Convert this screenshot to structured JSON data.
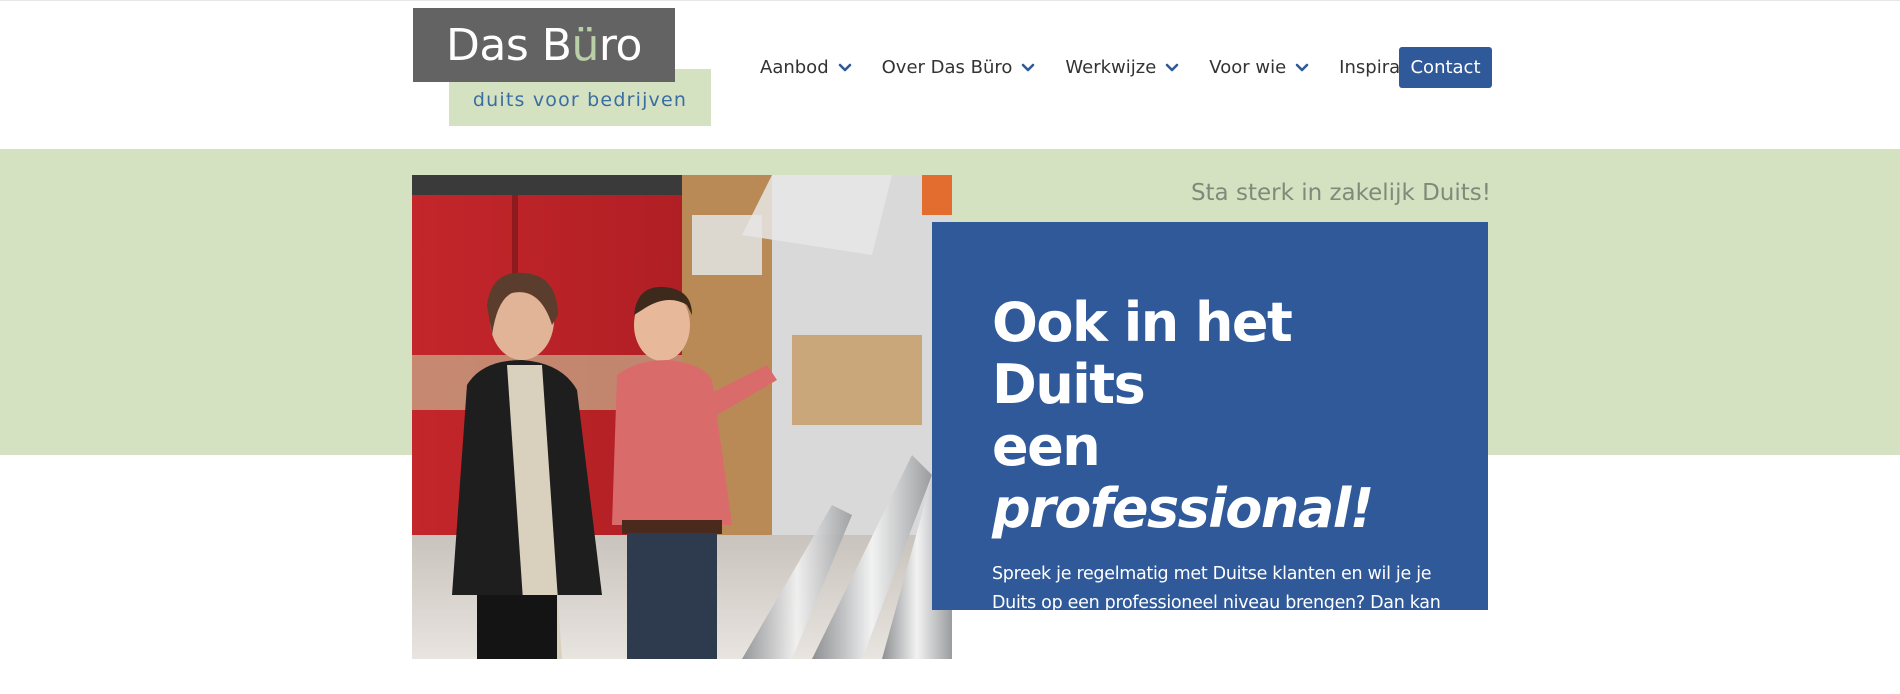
{
  "logo": {
    "name_part1": "Das B",
    "name_umlaut": "ü",
    "name_part2": "ro",
    "tagline": "duits voor bedrijven"
  },
  "nav": {
    "items": [
      {
        "label": "Aanbod",
        "icon": "chevron-down-icon"
      },
      {
        "label": "Over Das Büro",
        "icon": "chevron-down-icon"
      },
      {
        "label": "Werkwijze",
        "icon": "chevron-down-icon"
      },
      {
        "label": "Voor wie",
        "icon": "chevron-down-icon"
      },
      {
        "label": "Inspiratie",
        "icon": "chevron-down-icon"
      }
    ],
    "contact_label": "Contact"
  },
  "hero": {
    "tagline": "Sta sterk in zakelijk Duits!",
    "heading_line1": "Ook in het Duits",
    "heading_line2_prefix": "een ",
    "heading_line2_emphasis": "professional!",
    "body": "Spreek je regelmatig met Duitse klanten en wil je je Duits op een professioneel niveau brengen?  Dan kan een training een oplossing zijn!"
  },
  "colors": {
    "brand_blue": "#30599a",
    "light_green": "#d5e2c1",
    "logo_gray": "#636363"
  }
}
